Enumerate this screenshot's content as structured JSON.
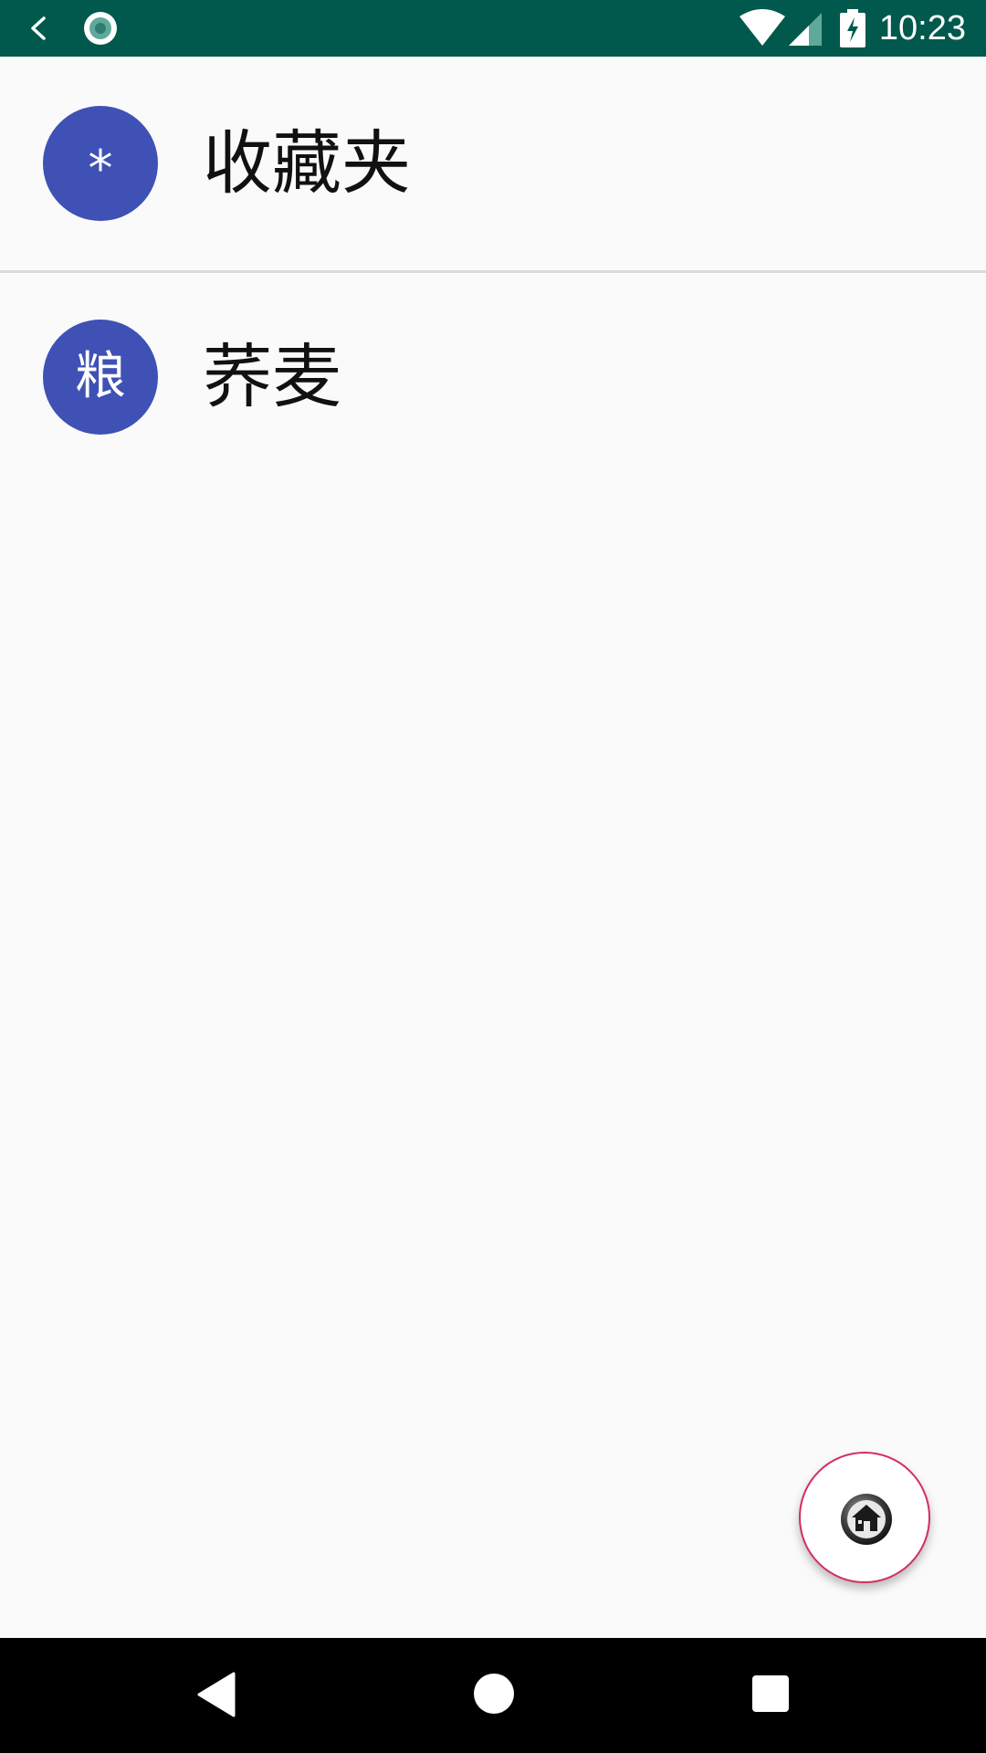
{
  "status_bar": {
    "time": "10:23",
    "color": "#00594c",
    "icons": [
      "back-chevron-icon",
      "app-status-icon",
      "wifi-icon",
      "signal-icon",
      "battery-charging-icon"
    ]
  },
  "list": {
    "items": [
      {
        "avatar_text": "*",
        "label": "收藏夹"
      },
      {
        "avatar_text": "粮",
        "label": "荞麦"
      }
    ],
    "avatar_color": "#3f51b5"
  },
  "fab": {
    "icon": "home-icon",
    "border_color": "#d32f5c"
  },
  "nav_bar": {
    "icons": [
      "nav-back-icon",
      "nav-home-icon",
      "nav-recents-icon"
    ]
  }
}
